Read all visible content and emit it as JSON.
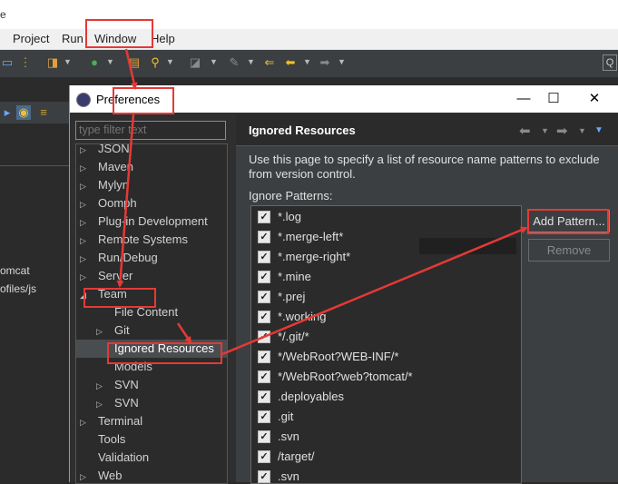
{
  "window": {
    "title_fragment": "e"
  },
  "menubar": {
    "items": [
      "Project",
      "Run",
      "Window",
      "Help"
    ]
  },
  "left_panel": {
    "text_1": "omcat",
    "text_2": "ofiles/js"
  },
  "dialog": {
    "title": "Preferences",
    "filter_placeholder": "type filter text",
    "tree": [
      {
        "label": "JSON",
        "twisty": "▷"
      },
      {
        "label": "Maven",
        "twisty": "▷"
      },
      {
        "label": "Mylyn",
        "twisty": "▷"
      },
      {
        "label": "Oomph",
        "twisty": "▷"
      },
      {
        "label": "Plug-in Development",
        "twisty": "▷"
      },
      {
        "label": "Remote Systems",
        "twisty": "▷"
      },
      {
        "label": "Run/Debug",
        "twisty": "▷"
      },
      {
        "label": "Server",
        "twisty": "▷"
      },
      {
        "label": "Team",
        "twisty": "◢"
      },
      {
        "label": "File Content",
        "twisty": ""
      },
      {
        "label": "Git",
        "twisty": "▷"
      },
      {
        "label": "Ignored Resources",
        "twisty": ""
      },
      {
        "label": "Models",
        "twisty": ""
      },
      {
        "label": "SVN",
        "twisty": "▷"
      },
      {
        "label": "SVN",
        "twisty": "▷"
      },
      {
        "label": "Terminal",
        "twisty": "▷"
      },
      {
        "label": "Tools",
        "twisty": ""
      },
      {
        "label": "Validation",
        "twisty": ""
      },
      {
        "label": "Web",
        "twisty": "▷"
      }
    ],
    "page_title": "Ignored Resources",
    "description": "Use this page to specify a list of resource name patterns to exclude from version control.",
    "ignore_patterns_label": "Ignore Patterns:",
    "patterns": [
      "*.log",
      "*.merge-left*",
      "*.merge-right*",
      "*.mine",
      "*.prej",
      "*.working",
      "*/.git/*",
      "*/WebRoot?WEB-INF/*",
      "*/WebRoot?web?tomcat/*",
      ".deployables",
      ".git",
      ".svn",
      "/target/",
      ".svn"
    ],
    "add_button": "Add Pattern...",
    "remove_button": "Remove"
  },
  "colors": {
    "annotation_red": "#e53935",
    "selection": "#4a4d50"
  }
}
